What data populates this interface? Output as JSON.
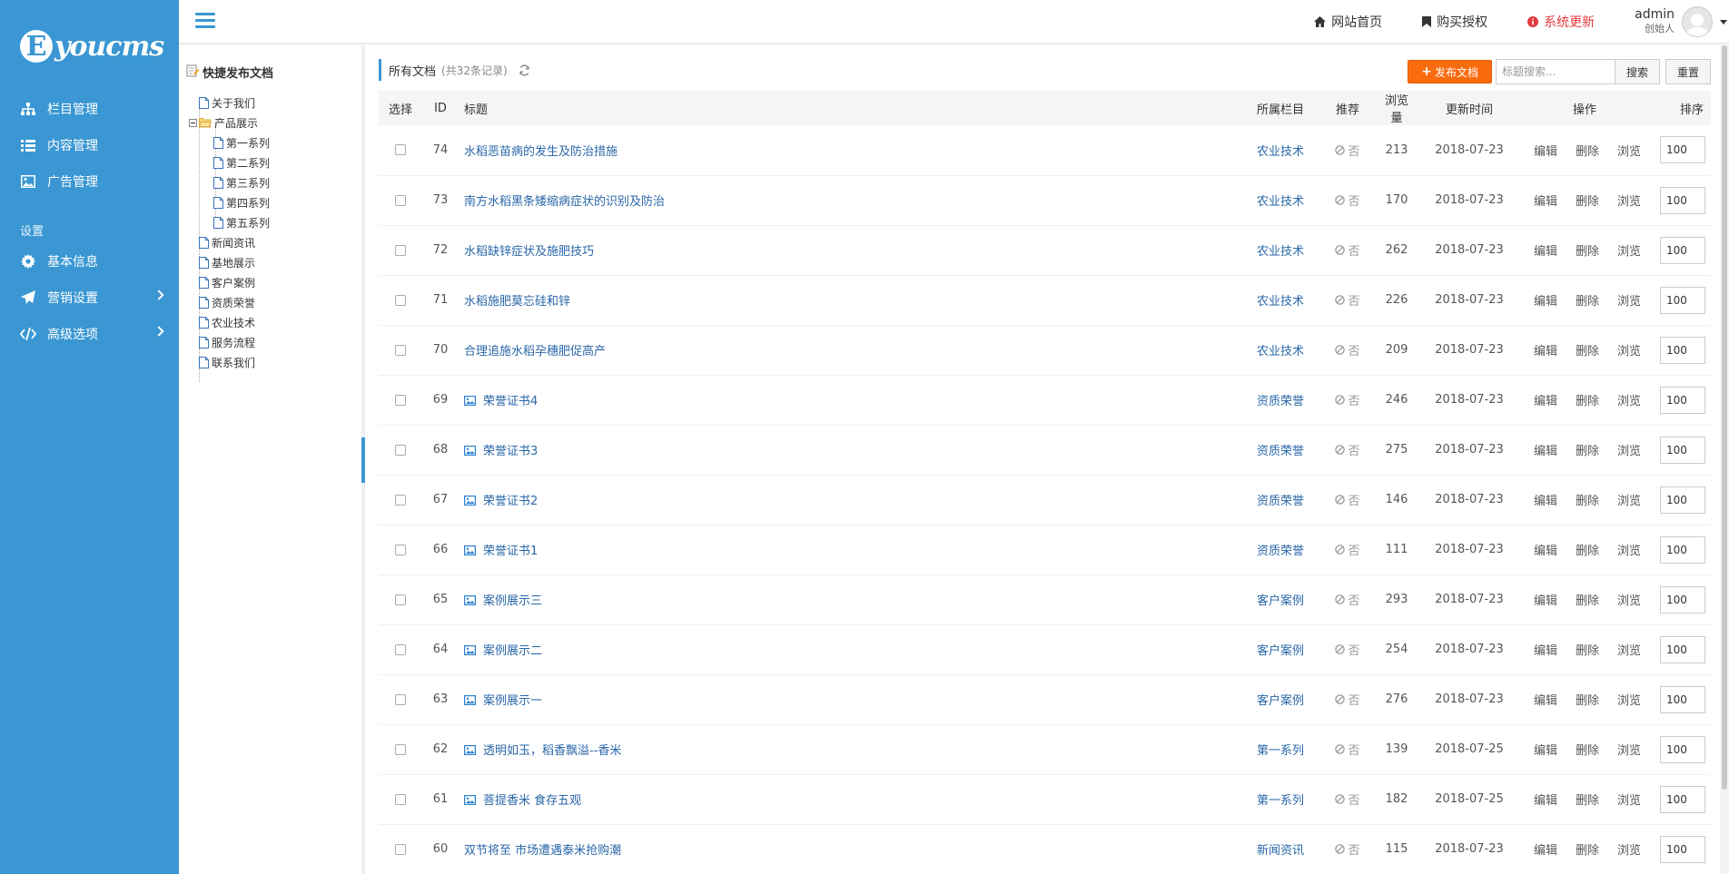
{
  "brand": {
    "logo_letter": "E",
    "logo_text": "youcms"
  },
  "sidebar": {
    "items": [
      {
        "label": "栏目管理",
        "icon": "sitemap-icon"
      },
      {
        "label": "内容管理",
        "icon": "list-icon"
      },
      {
        "label": "广告管理",
        "icon": "image-icon"
      }
    ],
    "group_title": "设置",
    "settings": [
      {
        "label": "基本信息",
        "icon": "gear-icon"
      },
      {
        "label": "营销设置",
        "icon": "paper-plane-icon"
      },
      {
        "label": "高级选项",
        "icon": "code-icon"
      }
    ]
  },
  "topbar": {
    "home": "网站首页",
    "license": "购买授权",
    "update": "系统更新",
    "user_name": "admin",
    "user_role": "创始人"
  },
  "tree": {
    "title": "快捷发布文档",
    "nodes": [
      "关于我们",
      "产品展示",
      "第一系列",
      "第二系列",
      "第三系列",
      "第四系列",
      "第五系列",
      "新闻资讯",
      "基地展示",
      "客户案例",
      "资质荣誉",
      "农业技术",
      "服务流程",
      "联系我们"
    ]
  },
  "main": {
    "title": "所有文档",
    "count": "(共32条记录)",
    "publish_label": "发布文档",
    "search_placeholder": "标题搜索...",
    "search_label": "搜索",
    "reset_label": "重置",
    "columns": {
      "check": "选择",
      "id": "ID",
      "title": "标题",
      "cat": "所属栏目",
      "rec": "推荐",
      "views": "浏览量",
      "date": "更新时间",
      "ops": "操作",
      "sort": "排序"
    },
    "rec_text": "否",
    "op_edit": "编辑",
    "op_delete": "删除",
    "op_view": "浏览"
  },
  "rows": [
    {
      "id": "74",
      "title": "水稻恶苗病的发生及防治措施",
      "img": false,
      "cat": "农业技术",
      "views": "213",
      "date": "2018-07-23",
      "sort": "100"
    },
    {
      "id": "73",
      "title": "南方水稻黑条矮缩病症状的识别及防治",
      "img": false,
      "cat": "农业技术",
      "views": "170",
      "date": "2018-07-23",
      "sort": "100"
    },
    {
      "id": "72",
      "title": "水稻缺锌症状及施肥技巧",
      "img": false,
      "cat": "农业技术",
      "views": "262",
      "date": "2018-07-23",
      "sort": "100"
    },
    {
      "id": "71",
      "title": "水稻施肥莫忘硅和锌",
      "img": false,
      "cat": "农业技术",
      "views": "226",
      "date": "2018-07-23",
      "sort": "100"
    },
    {
      "id": "70",
      "title": "合理追施水稻孕穗肥促高产",
      "img": false,
      "cat": "农业技术",
      "views": "209",
      "date": "2018-07-23",
      "sort": "100"
    },
    {
      "id": "69",
      "title": "荣誉证书4",
      "img": true,
      "cat": "资质荣誉",
      "views": "246",
      "date": "2018-07-23",
      "sort": "100"
    },
    {
      "id": "68",
      "title": "荣誉证书3",
      "img": true,
      "cat": "资质荣誉",
      "views": "275",
      "date": "2018-07-23",
      "sort": "100"
    },
    {
      "id": "67",
      "title": "荣誉证书2",
      "img": true,
      "cat": "资质荣誉",
      "views": "146",
      "date": "2018-07-23",
      "sort": "100"
    },
    {
      "id": "66",
      "title": "荣誉证书1",
      "img": true,
      "cat": "资质荣誉",
      "views": "111",
      "date": "2018-07-23",
      "sort": "100"
    },
    {
      "id": "65",
      "title": "案例展示三",
      "img": true,
      "cat": "客户案例",
      "views": "293",
      "date": "2018-07-23",
      "sort": "100"
    },
    {
      "id": "64",
      "title": "案例展示二",
      "img": true,
      "cat": "客户案例",
      "views": "254",
      "date": "2018-07-23",
      "sort": "100"
    },
    {
      "id": "63",
      "title": "案例展示一",
      "img": true,
      "cat": "客户案例",
      "views": "276",
      "date": "2018-07-23",
      "sort": "100"
    },
    {
      "id": "62",
      "title": "透明如玉，稻香飘溢--香米",
      "img": true,
      "cat": "第一系列",
      "views": "139",
      "date": "2018-07-25",
      "sort": "100"
    },
    {
      "id": "61",
      "title": "菩提香米 食存五观",
      "img": true,
      "cat": "第一系列",
      "views": "182",
      "date": "2018-07-25",
      "sort": "100"
    },
    {
      "id": "60",
      "title": "双节将至 市场遭遇泰米抢购潮",
      "img": false,
      "cat": "新闻资讯",
      "views": "115",
      "date": "2018-07-23",
      "sort": "100"
    }
  ]
}
